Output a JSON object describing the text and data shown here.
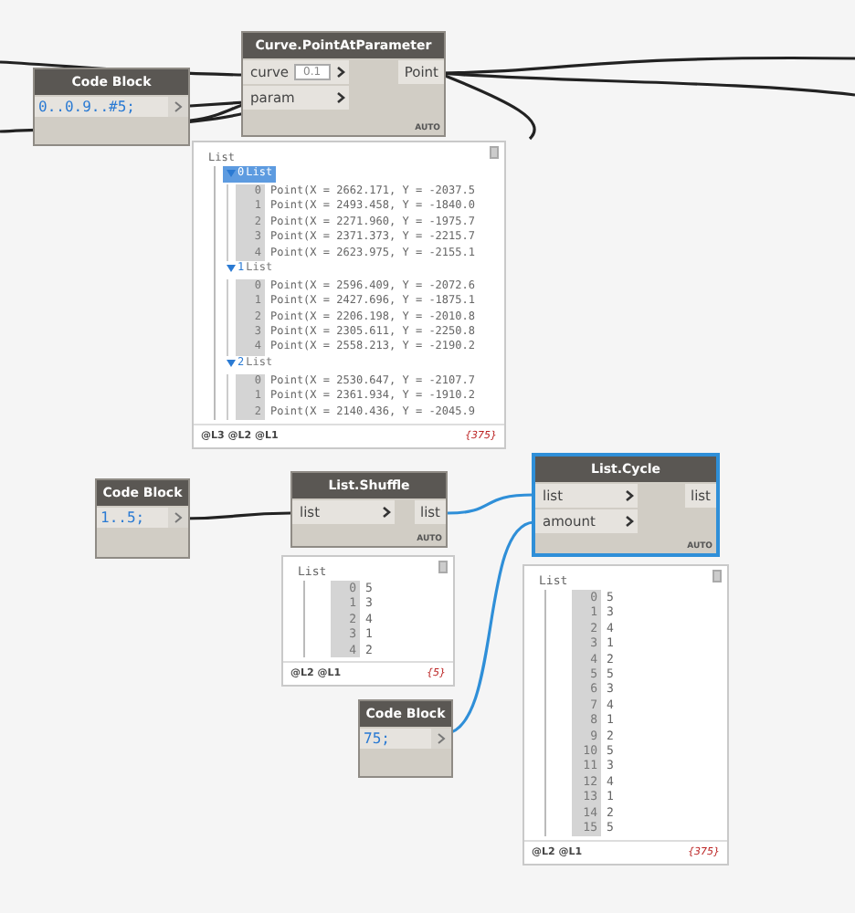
{
  "nodes": [
    {
      "kind": "code",
      "title": "Code Block",
      "code": "0..0.9..#5;",
      "selected": false
    },
    {
      "kind": "function",
      "title": "Curve.PointAtParameter",
      "inputs": [
        {
          "label": "curve",
          "value": "0.1"
        },
        {
          "label": "param"
        }
      ],
      "outputs": [
        "Point"
      ],
      "lacing": "AUTO",
      "selected": false
    },
    {
      "kind": "code",
      "title": "Code Block",
      "code": "1..5;",
      "selected": false
    },
    {
      "kind": "function",
      "title": "List.Shuffle",
      "inputs": [
        {
          "label": "list"
        }
      ],
      "outputs": [
        "list"
      ],
      "lacing": "AUTO",
      "selected": false
    },
    {
      "kind": "code",
      "title": "Code Block",
      "code": "75;",
      "selected": false
    },
    {
      "kind": "function",
      "title": "List.Cycle",
      "inputs": [
        {
          "label": "list"
        },
        {
          "label": "amount"
        }
      ],
      "outputs": [
        "list"
      ],
      "lacing": "AUTO",
      "selected": true
    }
  ],
  "previews": [
    {
      "root": "List",
      "levels": "@L3 @L2 @L1",
      "count": "{375}",
      "items": [
        {
          "index": "0",
          "label": "List",
          "selected": true,
          "expanded": true,
          "children": [
            {
              "index": "0",
              "value": "Point(X = 2662.171, Y = -2037.5"
            },
            {
              "index": "1",
              "value": "Point(X = 2493.458, Y = -1840.0"
            },
            {
              "index": "2",
              "value": "Point(X = 2271.960, Y = -1975.7"
            },
            {
              "index": "3",
              "value": "Point(X = 2371.373, Y = -2215.7"
            },
            {
              "index": "4",
              "value": "Point(X = 2623.975, Y = -2155.1"
            }
          ]
        },
        {
          "index": "1",
          "label": "List",
          "selected": false,
          "expanded": true,
          "children": [
            {
              "index": "0",
              "value": "Point(X = 2596.409, Y = -2072.6"
            },
            {
              "index": "1",
              "value": "Point(X = 2427.696, Y = -1875.1"
            },
            {
              "index": "2",
              "value": "Point(X = 2206.198, Y = -2010.8"
            },
            {
              "index": "3",
              "value": "Point(X = 2305.611, Y = -2250.8"
            },
            {
              "index": "4",
              "value": "Point(X = 2558.213, Y = -2190.2"
            }
          ]
        },
        {
          "index": "2",
          "label": "List",
          "selected": false,
          "expanded": true,
          "children": [
            {
              "index": "0",
              "value": "Point(X = 2530.647, Y = -2107.7"
            },
            {
              "index": "1",
              "value": "Point(X = 2361.934, Y = -1910.2"
            },
            {
              "index": "2",
              "value": "Point(X = 2140.436, Y = -2045.9"
            }
          ]
        }
      ]
    },
    {
      "root": "List",
      "levels": "@L2 @L1",
      "count": "{5}",
      "items": [
        {
          "index": "0",
          "value": "5"
        },
        {
          "index": "1",
          "value": "3"
        },
        {
          "index": "2",
          "value": "4"
        },
        {
          "index": "3",
          "value": "1"
        },
        {
          "index": "4",
          "value": "2"
        }
      ]
    },
    {
      "root": "List",
      "levels": "@L2 @L1",
      "count": "{375}",
      "items": [
        {
          "index": "0",
          "value": "5"
        },
        {
          "index": "1",
          "value": "3"
        },
        {
          "index": "2",
          "value": "4"
        },
        {
          "index": "3",
          "value": "1"
        },
        {
          "index": "4",
          "value": "2"
        },
        {
          "index": "5",
          "value": "5"
        },
        {
          "index": "6",
          "value": "3"
        },
        {
          "index": "7",
          "value": "4"
        },
        {
          "index": "8",
          "value": "1"
        },
        {
          "index": "9",
          "value": "2"
        },
        {
          "index": "10",
          "value": "5"
        },
        {
          "index": "11",
          "value": "3"
        },
        {
          "index": "12",
          "value": "4"
        },
        {
          "index": "13",
          "value": "1"
        },
        {
          "index": "14",
          "value": "2"
        },
        {
          "index": "15",
          "value": "5"
        }
      ]
    }
  ]
}
